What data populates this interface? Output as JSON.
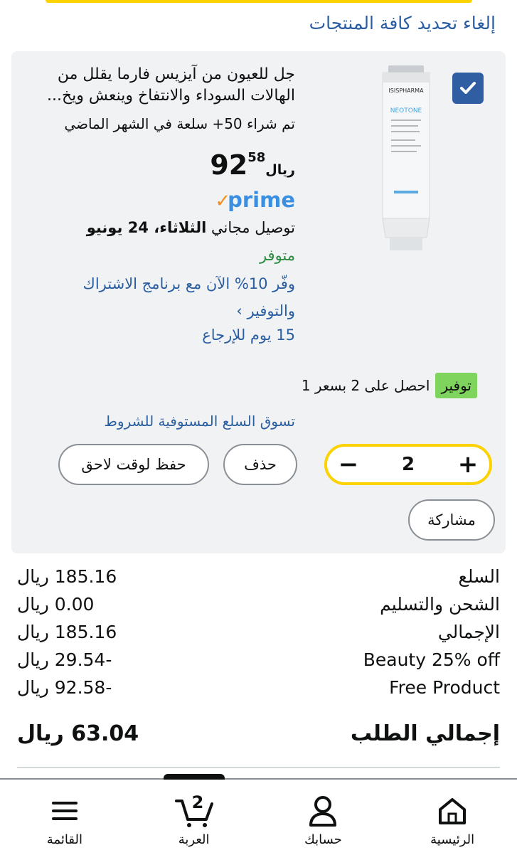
{
  "header": {
    "deselect_all": "إلغاء تحديد كافة المنتجات"
  },
  "product": {
    "selected": true,
    "title": "جل للعيون من آيزيس فارما يقلل من الهالات السوداء والانتفاخ وينعش ويخ...",
    "bought_note": "تم شراء 50+ سلعة في الشهر الماضي",
    "price_currency": "ريال",
    "price_whole": "92",
    "price_fraction": "58",
    "prime_label": "prime",
    "delivery_prefix": "توصيل مجاني ",
    "delivery_date": "الثلاثاء، 24 يونيو",
    "stock_status": "متوفر",
    "subscribe_save": "وفّر 10% الآن مع برنامج الاشتراك والتوفير ›",
    "returns": "15 يوم للإرجاع",
    "deal_badge": "توفير",
    "deal_text": "احصل على 2 بسعر 1",
    "qualify_link": "تسوق السلع المستوفية للشروط",
    "quantity": "2",
    "delete_label": "حذف",
    "save_later_label": "حفظ لوقت لاحق",
    "share_label": "مشاركة",
    "image_texts": {
      "brand": "ISISPHARMA",
      "line": "NEOTONE"
    }
  },
  "summary": {
    "rows": [
      {
        "label": "السلع",
        "value": "185.16 ريال"
      },
      {
        "label": "الشحن والتسليم",
        "value": "0.00 ريال"
      },
      {
        "label": "الإجمالي",
        "value": "185.16 ريال"
      },
      {
        "label": "Beauty 25% off",
        "value": "-29.54 ريال"
      },
      {
        "label": "Free Product",
        "value": "-92.58 ريال"
      }
    ],
    "total_label": "إجمالي الطلب",
    "total_value": "63.04 ريال"
  },
  "bottom_nav": {
    "home": "الرئيسية",
    "account": "حسابك",
    "cart": "العربة",
    "cart_count": "2",
    "menu": "القائمة"
  },
  "colors": {
    "link": "#2a5ea1",
    "checkbox": "#2f5ea3",
    "stepper_border": "#fcd200",
    "in_stock": "#2a8a3e",
    "deal_badge": "#7fd45d",
    "prime": "#3a8fe0"
  }
}
